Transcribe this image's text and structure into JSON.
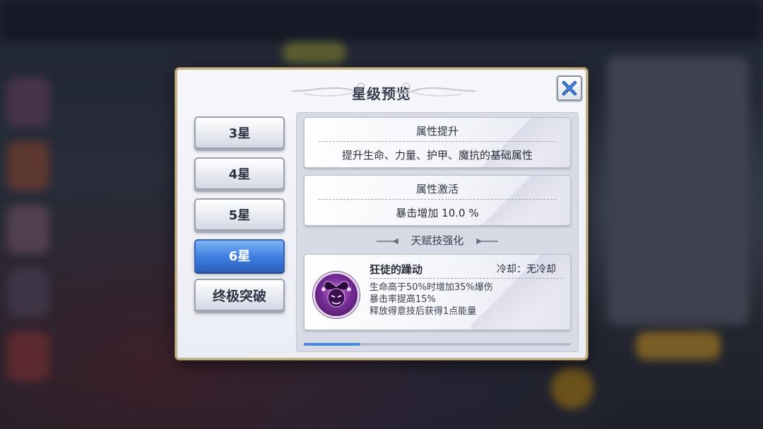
{
  "dialog": {
    "title": "星级预览",
    "close_icon": "close-x-icon"
  },
  "tabs": [
    {
      "label": "3星",
      "active": false
    },
    {
      "label": "4星",
      "active": false
    },
    {
      "label": "5星",
      "active": false
    },
    {
      "label": "6星",
      "active": true
    },
    {
      "label": "终极突破",
      "active": false
    }
  ],
  "attribute_boost": {
    "title": "属性提升",
    "text": "提升生命、力量、护甲、魔抗的基础属性"
  },
  "attribute_activate": {
    "title": "属性激活",
    "text": "暴击增加 10.0 %"
  },
  "talent_section": {
    "label": "天赋技强化"
  },
  "skill": {
    "icon": "jester-mask-icon",
    "name": "狂徒的躁动",
    "cooldown": "冷却：无冷却",
    "lines": [
      "生命高于50%时增加35%爆伤",
      "暴击率提高15%",
      "释放得意技后获得1点能量"
    ]
  },
  "colors": {
    "accent_blue": "#3f7fe0",
    "frame_gold": "#c8b48a"
  }
}
